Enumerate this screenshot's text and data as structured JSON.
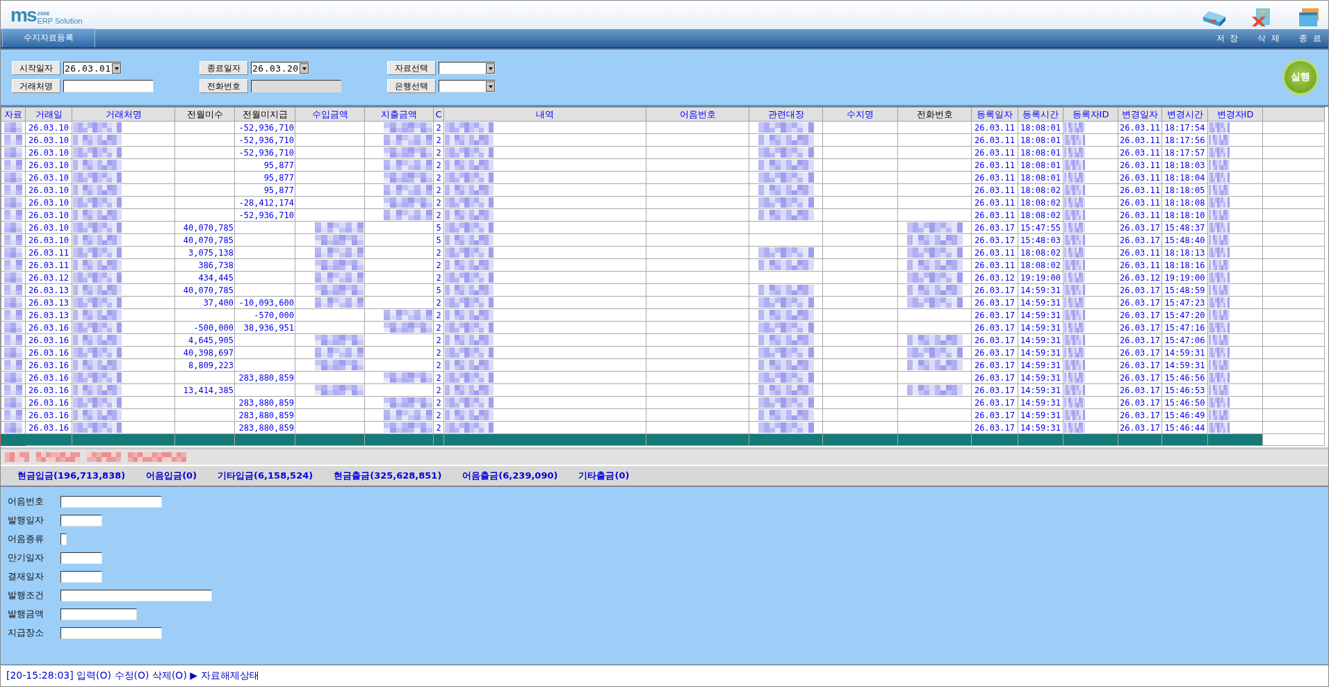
{
  "logo": {
    "mark": "ms",
    "year": "2006",
    "name": "ERP Solution"
  },
  "toolbar": [
    {
      "label": "저 장",
      "kind": "save"
    },
    {
      "label": "삭 제",
      "kind": "delete"
    },
    {
      "label": "종 료",
      "kind": "exit"
    }
  ],
  "tabs": [
    {
      "label": "수지자료등록",
      "selected": true
    }
  ],
  "filters": [
    {
      "label": "시작일자",
      "kind": "select",
      "value": "26.03.01",
      "disabled": false
    },
    {
      "label": "종료일자",
      "kind": "select",
      "value": "26.03.20",
      "disabled": false
    },
    {
      "label": "자료선택",
      "kind": "select",
      "disabled": false
    },
    {
      "label": "거래처명",
      "kind": "text",
      "disabled": false
    },
    {
      "label": "전화번호",
      "kind": "text",
      "disabled": true
    },
    {
      "label": "은행선택",
      "kind": "select",
      "disabled": false
    }
  ],
  "run_button": {
    "label": "실행"
  },
  "table": {
    "columns": [
      {
        "label": "자료",
        "kind": "code",
        "emphasis": true
      },
      {
        "label": "거래일",
        "kind": "code",
        "emphasis": true
      },
      {
        "label": "거래처명",
        "kind": "text",
        "emphasis": true
      },
      {
        "label": "전월미수",
        "kind": "amount",
        "emphasis": false
      },
      {
        "label": "전월미지급",
        "kind": "amount",
        "emphasis": false
      },
      {
        "label": "수입금액",
        "kind": "amount",
        "emphasis": true
      },
      {
        "label": "지출금액",
        "kind": "amount",
        "emphasis": true
      },
      {
        "label": "C",
        "kind": "code",
        "emphasis": true
      },
      {
        "label": "내역",
        "kind": "text",
        "emphasis": true
      },
      {
        "label": "어음번호",
        "kind": "text",
        "emphasis": true
      },
      {
        "label": "관련대장",
        "kind": "text",
        "emphasis": true
      },
      {
        "label": "수지명",
        "kind": "text",
        "emphasis": true
      },
      {
        "label": "전화번호",
        "kind": "text",
        "emphasis": false
      },
      {
        "label": "등록일자",
        "kind": "code",
        "emphasis": true
      },
      {
        "label": "등록시간",
        "kind": "code",
        "emphasis": true
      },
      {
        "label": "등록자ID",
        "kind": "text",
        "emphasis": true
      },
      {
        "label": "변경일자",
        "kind": "code",
        "emphasis": true
      },
      {
        "label": "변경시간",
        "kind": "code",
        "emphasis": true
      },
      {
        "label": "변경자ID",
        "kind": "text",
        "emphasis": true
      }
    ],
    "rows": [
      {
        "cells": [
          {
            "masked": true
          },
          "26.03.10",
          {
            "masked": true
          },
          null,
          "-52,936,710",
          null,
          {
            "masked": true
          },
          "2",
          {
            "masked": true
          },
          null,
          {
            "masked": true
          },
          null,
          null,
          "26.03.11",
          "18:08:01",
          {
            "masked": true
          },
          "26.03.11",
          "18:17:54",
          {
            "masked": true
          }
        ]
      },
      {
        "cells": [
          {
            "masked": true
          },
          "26.03.10",
          {
            "masked": true
          },
          null,
          "-52,936,710",
          null,
          {
            "masked": true
          },
          "2",
          {
            "masked": true
          },
          null,
          {
            "masked": true
          },
          null,
          null,
          "26.03.11",
          "18:08:01",
          {
            "masked": true
          },
          "26.03.11",
          "18:17:56",
          {
            "masked": true
          }
        ]
      },
      {
        "cells": [
          {
            "masked": true
          },
          "26.03.10",
          {
            "masked": true
          },
          null,
          "-52,936,710",
          null,
          {
            "masked": true
          },
          "2",
          {
            "masked": true
          },
          null,
          {
            "masked": true
          },
          null,
          null,
          "26.03.11",
          "18:08:01",
          {
            "masked": true
          },
          "26.03.11",
          "18:17:57",
          {
            "masked": true
          }
        ]
      },
      {
        "cells": [
          {
            "masked": true
          },
          "26.03.10",
          {
            "masked": true
          },
          null,
          "95,877",
          null,
          {
            "masked": true
          },
          "2",
          {
            "masked": true
          },
          null,
          {
            "masked": true
          },
          null,
          null,
          "26.03.11",
          "18:08:01",
          {
            "masked": true
          },
          "26.03.11",
          "18:18:03",
          {
            "masked": true
          }
        ]
      },
      {
        "cells": [
          {
            "masked": true
          },
          "26.03.10",
          {
            "masked": true
          },
          null,
          "95,877",
          null,
          {
            "masked": true
          },
          "2",
          {
            "masked": true
          },
          null,
          {
            "masked": true
          },
          null,
          null,
          "26.03.11",
          "18:08:01",
          {
            "masked": true
          },
          "26.03.11",
          "18:18:04",
          {
            "masked": true
          }
        ]
      },
      {
        "cells": [
          {
            "masked": true
          },
          "26.03.10",
          {
            "masked": true
          },
          null,
          "95,877",
          null,
          {
            "masked": true
          },
          "2",
          {
            "masked": true
          },
          null,
          {
            "masked": true
          },
          null,
          null,
          "26.03.11",
          "18:08:02",
          {
            "masked": true
          },
          "26.03.11",
          "18:18:05",
          {
            "masked": true
          }
        ]
      },
      {
        "cells": [
          {
            "masked": true
          },
          "26.03.10",
          {
            "masked": true
          },
          null,
          "-28,412,174",
          null,
          {
            "masked": true
          },
          "2",
          {
            "masked": true
          },
          null,
          {
            "masked": true
          },
          null,
          null,
          "26.03.11",
          "18:08:02",
          {
            "masked": true
          },
          "26.03.11",
          "18:18:08",
          {
            "masked": true
          }
        ]
      },
      {
        "cells": [
          {
            "masked": true
          },
          "26.03.10",
          {
            "masked": true
          },
          null,
          "-52,936,710",
          null,
          {
            "masked": true
          },
          "2",
          {
            "masked": true
          },
          null,
          {
            "masked": true
          },
          null,
          null,
          "26.03.11",
          "18:08:02",
          {
            "masked": true
          },
          "26.03.11",
          "18:18:10",
          {
            "masked": true
          }
        ]
      },
      {
        "cells": [
          {
            "masked": true
          },
          "26.03.10",
          {
            "masked": true
          },
          "40,070,785",
          null,
          {
            "masked": true
          },
          null,
          "5",
          {
            "masked": true
          },
          null,
          null,
          null,
          {
            "masked": true
          },
          "26.03.17",
          "15:47:55",
          {
            "masked": true
          },
          "26.03.17",
          "15:48:37",
          {
            "masked": true
          }
        ]
      },
      {
        "cells": [
          {
            "masked": true
          },
          "26.03.10",
          {
            "masked": true
          },
          "40,070,785",
          null,
          {
            "masked": true
          },
          null,
          "5",
          {
            "masked": true
          },
          null,
          null,
          null,
          {
            "masked": true
          },
          "26.03.17",
          "15:48:03",
          {
            "masked": true
          },
          "26.03.17",
          "15:48:40",
          {
            "masked": true
          }
        ]
      },
      {
        "cells": [
          {
            "masked": true
          },
          "26.03.11",
          {
            "masked": true
          },
          "3,075,138",
          null,
          {
            "masked": true
          },
          null,
          "2",
          {
            "masked": true
          },
          null,
          {
            "masked": true
          },
          null,
          {
            "masked": true
          },
          "26.03.11",
          "18:08:02",
          {
            "masked": true
          },
          "26.03.11",
          "18:18:13",
          {
            "masked": true
          }
        ]
      },
      {
        "cells": [
          {
            "masked": true
          },
          "26.03.11",
          {
            "masked": true
          },
          "386,738",
          null,
          {
            "masked": true
          },
          null,
          "2",
          {
            "masked": true
          },
          null,
          {
            "masked": true
          },
          null,
          {
            "masked": true
          },
          "26.03.11",
          "18:08:02",
          {
            "masked": true
          },
          "26.03.11",
          "18:18:16",
          {
            "masked": true
          }
        ]
      },
      {
        "cells": [
          {
            "masked": true
          },
          "26.03.12",
          {
            "masked": true
          },
          "434,445",
          null,
          {
            "masked": true
          },
          null,
          "2",
          {
            "masked": true
          },
          null,
          null,
          null,
          {
            "masked": true
          },
          "26.03.12",
          "19:19:00",
          {
            "masked": true
          },
          "26.03.12",
          "19:19:00",
          {
            "masked": true
          }
        ]
      },
      {
        "cells": [
          {
            "masked": true
          },
          "26.03.13",
          {
            "masked": true
          },
          "40,070,785",
          null,
          {
            "masked": true
          },
          null,
          "5",
          {
            "masked": true
          },
          null,
          {
            "masked": true
          },
          null,
          {
            "masked": true
          },
          "26.03.17",
          "14:59:31",
          {
            "masked": true
          },
          "26.03.17",
          "15:48:59",
          {
            "masked": true
          }
        ]
      },
      {
        "cells": [
          {
            "masked": true
          },
          "26.03.13",
          {
            "masked": true
          },
          "37,400",
          "-10,093,600",
          {
            "masked": true
          },
          null,
          "2",
          {
            "masked": true
          },
          null,
          {
            "masked": true
          },
          null,
          {
            "masked": true
          },
          "26.03.17",
          "14:59:31",
          {
            "masked": true
          },
          "26.03.17",
          "15:47:23",
          {
            "masked": true
          }
        ]
      },
      {
        "cells": [
          {
            "masked": true
          },
          "26.03.13",
          {
            "masked": true
          },
          null,
          "-570,000",
          null,
          {
            "masked": true
          },
          "2",
          {
            "masked": true
          },
          null,
          {
            "masked": true
          },
          null,
          null,
          "26.03.17",
          "14:59:31",
          {
            "masked": true
          },
          "26.03.17",
          "15:47:20",
          {
            "masked": true
          }
        ]
      },
      {
        "cells": [
          {
            "masked": true
          },
          "26.03.16",
          {
            "masked": true
          },
          "-500,000",
          "38,936,951",
          null,
          {
            "masked": true
          },
          "2",
          {
            "masked": true
          },
          null,
          {
            "masked": true
          },
          null,
          null,
          "26.03.17",
          "14:59:31",
          {
            "masked": true
          },
          "26.03.17",
          "15:47:16",
          {
            "masked": true
          }
        ]
      },
      {
        "cells": [
          {
            "masked": true
          },
          "26.03.16",
          {
            "masked": true
          },
          "4,645,905",
          null,
          {
            "masked": true
          },
          null,
          "2",
          {
            "masked": true
          },
          null,
          {
            "masked": true
          },
          null,
          {
            "masked": true
          },
          "26.03.17",
          "14:59:31",
          {
            "masked": true
          },
          "26.03.17",
          "15:47:06",
          {
            "masked": true
          }
        ]
      },
      {
        "cells": [
          {
            "masked": true
          },
          "26.03.16",
          {
            "masked": true
          },
          "40,398,697",
          null,
          {
            "masked": true
          },
          null,
          "2",
          {
            "masked": true
          },
          null,
          {
            "masked": true
          },
          null,
          {
            "masked": true
          },
          "26.03.17",
          "14:59:31",
          {
            "masked": true
          },
          "26.03.17",
          "14:59:31",
          {
            "masked": true
          }
        ]
      },
      {
        "cells": [
          {
            "masked": true
          },
          "26.03.16",
          {
            "masked": true
          },
          "8,809,223",
          null,
          {
            "masked": true
          },
          null,
          "2",
          {
            "masked": true
          },
          null,
          {
            "masked": true
          },
          null,
          {
            "masked": true
          },
          "26.03.17",
          "14:59:31",
          {
            "masked": true
          },
          "26.03.17",
          "14:59:31",
          {
            "masked": true
          }
        ]
      },
      {
        "cells": [
          {
            "masked": true
          },
          "26.03.16",
          {
            "masked": true
          },
          null,
          "283,880,859",
          null,
          {
            "masked": true
          },
          "2",
          {
            "masked": true
          },
          null,
          {
            "masked": true
          },
          null,
          null,
          "26.03.17",
          "14:59:31",
          {
            "masked": true
          },
          "26.03.17",
          "15:46:56",
          {
            "masked": true
          }
        ]
      },
      {
        "cells": [
          {
            "masked": true
          },
          "26.03.16",
          {
            "masked": true
          },
          "13,414,385",
          null,
          {
            "masked": true
          },
          null,
          "2",
          {
            "masked": true
          },
          null,
          {
            "masked": true
          },
          null,
          {
            "masked": true
          },
          "26.03.17",
          "14:59:31",
          {
            "masked": true
          },
          "26.03.17",
          "15:46:53",
          {
            "masked": true
          }
        ]
      },
      {
        "cells": [
          {
            "masked": true
          },
          "26.03.16",
          {
            "masked": true
          },
          null,
          "283,880,859",
          null,
          {
            "masked": true
          },
          "2",
          {
            "masked": true
          },
          null,
          {
            "masked": true
          },
          null,
          null,
          "26.03.17",
          "14:59:31",
          {
            "masked": true
          },
          "26.03.17",
          "15:46:50",
          {
            "masked": true
          }
        ]
      },
      {
        "cells": [
          {
            "masked": true
          },
          "26.03.16",
          {
            "masked": true
          },
          null,
          "283,880,859",
          null,
          {
            "masked": true
          },
          "2",
          {
            "masked": true
          },
          null,
          {
            "masked": true
          },
          null,
          null,
          "26.03.17",
          "14:59:31",
          {
            "masked": true
          },
          "26.03.17",
          "15:46:49",
          {
            "masked": true
          }
        ]
      },
      {
        "cells": [
          {
            "masked": true
          },
          "26.03.16",
          {
            "masked": true
          },
          null,
          "283,880,859",
          null,
          {
            "masked": true
          },
          "2",
          {
            "masked": true
          },
          null,
          {
            "masked": true
          },
          null,
          null,
          "26.03.17",
          "14:59:31",
          {
            "masked": true
          },
          "26.03.17",
          "15:46:44",
          {
            "masked": true
          }
        ]
      }
    ],
    "new_row": {
      "selected": true
    }
  },
  "note_bar": {
    "masked": true
  },
  "totals": [
    "현금입금(196,713,838)",
    "어음입금(0)",
    "기타입금(6,158,524)",
    "현금출금(325,628,851)",
    "어음출금(6,239,090)",
    "기타출금(0)"
  ],
  "form": [
    {
      "label": "어음번호",
      "kind": "long"
    },
    {
      "label": "발행일자",
      "kind": "short"
    },
    {
      "label": "어음종류",
      "kind": "tiny"
    },
    {
      "label": "만기일자",
      "kind": "short"
    },
    {
      "label": "결재일자",
      "kind": "short"
    },
    {
      "label": "발행조건",
      "kind": "wide"
    },
    {
      "label": "발행금액",
      "kind": "medium"
    },
    {
      "label": "지급장소",
      "kind": "long"
    }
  ],
  "status_bar": "[20-15:28:03] 입력(O) 수정(O) 삭제(O) ▶ 자료해제상태"
}
